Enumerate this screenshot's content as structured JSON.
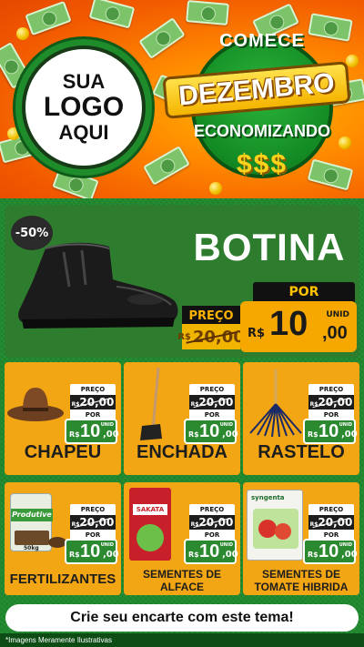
{
  "header": {
    "logo_lines": [
      "SUA",
      "LOGO",
      "AQUI"
    ],
    "emblem_top": "COMECE",
    "emblem_main": "DEZEMBRO",
    "emblem_sub": "ECONOMIZANDO",
    "emblem_money": "$$$"
  },
  "featured": {
    "discount": "-50%",
    "title": "BOTINA",
    "preco_label": "PREÇO",
    "old_currency": "R$",
    "old_price": "20,00",
    "por_label": "POR",
    "currency": "R$",
    "price_int": "10",
    "price_dec": ",00",
    "unit": "UNID"
  },
  "products": [
    {
      "name": "CHAPEU",
      "preco_label": "PREÇO",
      "old_currency": "R$",
      "old_price": "20,00",
      "por_label": "POR",
      "currency": "R$",
      "price_int": "10",
      "price_dec": ",00",
      "unit": "UNID"
    },
    {
      "name": "ENCHADA",
      "preco_label": "PREÇO",
      "old_currency": "R$",
      "old_price": "20,00",
      "por_label": "POR",
      "currency": "R$",
      "price_int": "10",
      "price_dec": ",00",
      "unit": "UNID"
    },
    {
      "name": "RASTELO",
      "preco_label": "PREÇO",
      "old_currency": "R$",
      "old_price": "20,00",
      "por_label": "POR",
      "currency": "R$",
      "price_int": "10",
      "price_dec": ",00",
      "unit": "UNID"
    },
    {
      "name": "FERTILIZANTES",
      "product_label": "Produtive",
      "product_weight": "50kg",
      "preco_label": "PREÇO",
      "old_currency": "R$",
      "old_price": "20,00",
      "por_label": "POR",
      "currency": "R$",
      "price_int": "10",
      "price_dec": ",00",
      "unit": "UNID"
    },
    {
      "name_lines": [
        "SEMENTES DE",
        "ALFACE"
      ],
      "product_label": "SAKATA",
      "preco_label": "PREÇO",
      "old_currency": "R$",
      "old_price": "20,00",
      "por_label": "POR",
      "currency": "R$",
      "price_int": "10",
      "price_dec": ",00",
      "unit": "UNID"
    },
    {
      "name_lines": [
        "SEMENTES DE",
        "TOMATE HIBRIDA"
      ],
      "product_label": "syngenta",
      "preco_label": "PREÇO",
      "old_currency": "R$",
      "old_price": "20,00",
      "por_label": "POR",
      "currency": "R$",
      "price_int": "10",
      "price_dec": ",00",
      "unit": "UNID"
    }
  ],
  "footer": {
    "cta": "Crie seu encarte com este tema!",
    "disclaimer": "*Imagens Meramente Ilustrativas"
  },
  "colors": {
    "header_orange": "#f25a00",
    "body_green": "#1f8a2e",
    "card_orange": "#f3a613",
    "price_green": "#2b8a30"
  }
}
